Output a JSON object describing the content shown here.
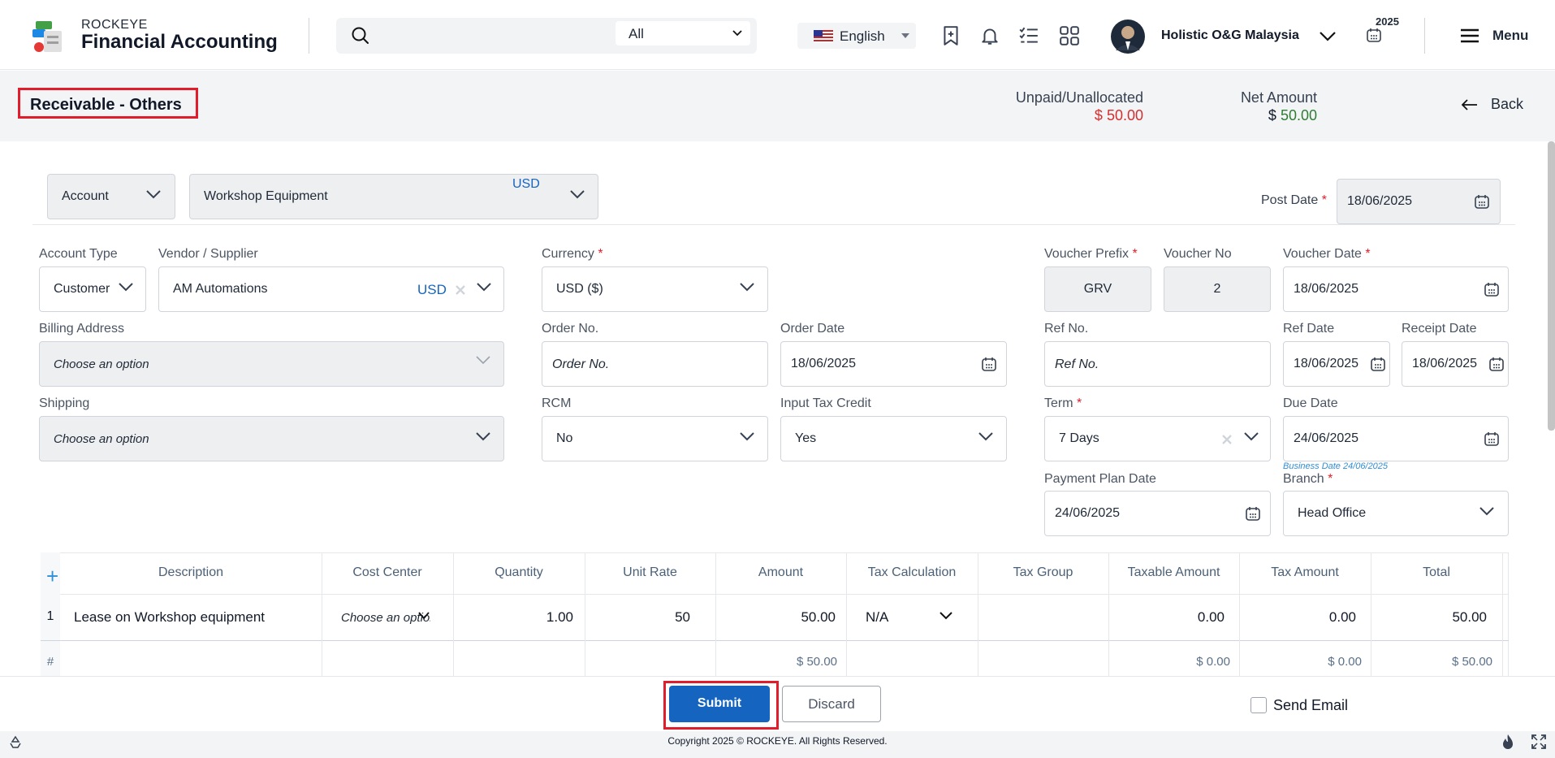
{
  "app": {
    "brand_small": "ROCKEYE",
    "brand_title": "Financial Accounting",
    "search_scope": "All",
    "language": "English",
    "company": "Holistic O&G Malaysia",
    "year": "2025",
    "menu_label": "Menu"
  },
  "page": {
    "title": "Receivable - Others",
    "unpaid_label": "Unpaid/Unallocated",
    "unpaid_currency": "$",
    "unpaid_value": "50.00",
    "net_label": "Net Amount",
    "net_currency": "$",
    "net_value": "50.00",
    "back_label": "Back"
  },
  "account_bar": {
    "account_select": "Account",
    "account_value": "Workshop Equipment",
    "account_currency": "USD",
    "post_date_label": "Post Date",
    "post_date": "18/06/2025"
  },
  "form": {
    "account_type_label": "Account Type",
    "account_type": "Customer",
    "vendor_label": "Vendor / Supplier",
    "vendor": "AM Automations",
    "vendor_currency": "USD",
    "currency_label": "Currency",
    "currency": "USD ($)",
    "voucher_prefix_label": "Voucher Prefix",
    "voucher_prefix": "GRV",
    "voucher_no_label": "Voucher No",
    "voucher_no": "2",
    "voucher_date_label": "Voucher Date",
    "voucher_date": "18/06/2025",
    "billing_label": "Billing Address",
    "billing_placeholder": "Choose an option",
    "order_no_label": "Order No.",
    "order_no_placeholder": "Order No.",
    "order_date_label": "Order Date",
    "order_date": "18/06/2025",
    "ref_no_label": "Ref No.",
    "ref_no_placeholder": "Ref No.",
    "ref_date_label": "Ref Date",
    "ref_date": "18/06/2025",
    "receipt_date_label": "Receipt Date",
    "receipt_date": "18/06/2025",
    "shipping_label": "Shipping",
    "shipping_placeholder": "Choose an option",
    "rcm_label": "RCM",
    "rcm": "No",
    "itc_label": "Input Tax Credit",
    "itc": "Yes",
    "term_label": "Term",
    "term": "7 Days",
    "due_date_label": "Due Date",
    "due_date": "24/06/2025",
    "business_date": "Business Date 24/06/2025",
    "payment_plan_label": "Payment Plan Date",
    "payment_plan_date": "24/06/2025",
    "branch_label": "Branch",
    "branch": "Head Office",
    "required_mark": "*"
  },
  "table": {
    "add_symbol": "+",
    "headers": [
      "Description",
      "Cost Center",
      "Quantity",
      "Unit Rate",
      "Amount",
      "Tax Calculation",
      "Tax Group",
      "Taxable Amount",
      "Tax Amount",
      "Total"
    ],
    "rows": [
      {
        "index": "1",
        "description": "Lease on Workshop equipment",
        "cost_center_placeholder": "Choose an option",
        "quantity": "1.00",
        "unit_rate": "50",
        "amount": "50.00",
        "tax_calculation": "N/A",
        "tax_group": "",
        "taxable_amount": "0.00",
        "tax_amount": "0.00",
        "total": "50.00"
      }
    ],
    "footer": {
      "hash": "#",
      "amount": "$ 50.00",
      "taxable_amount": "$ 0.00",
      "tax_amount": "$ 0.00",
      "total": "$ 50.00"
    }
  },
  "actions": {
    "submit": "Submit",
    "discard": "Discard",
    "send_email": "Send Email"
  },
  "footer": {
    "copyright": "Copyright 2025 © ROCKEYE. All Rights Reserved."
  },
  "colors": {
    "primary": "#1565c0",
    "highlight": "#e11d2b",
    "negative": "#d32f2f",
    "positive": "#2e7d32"
  }
}
